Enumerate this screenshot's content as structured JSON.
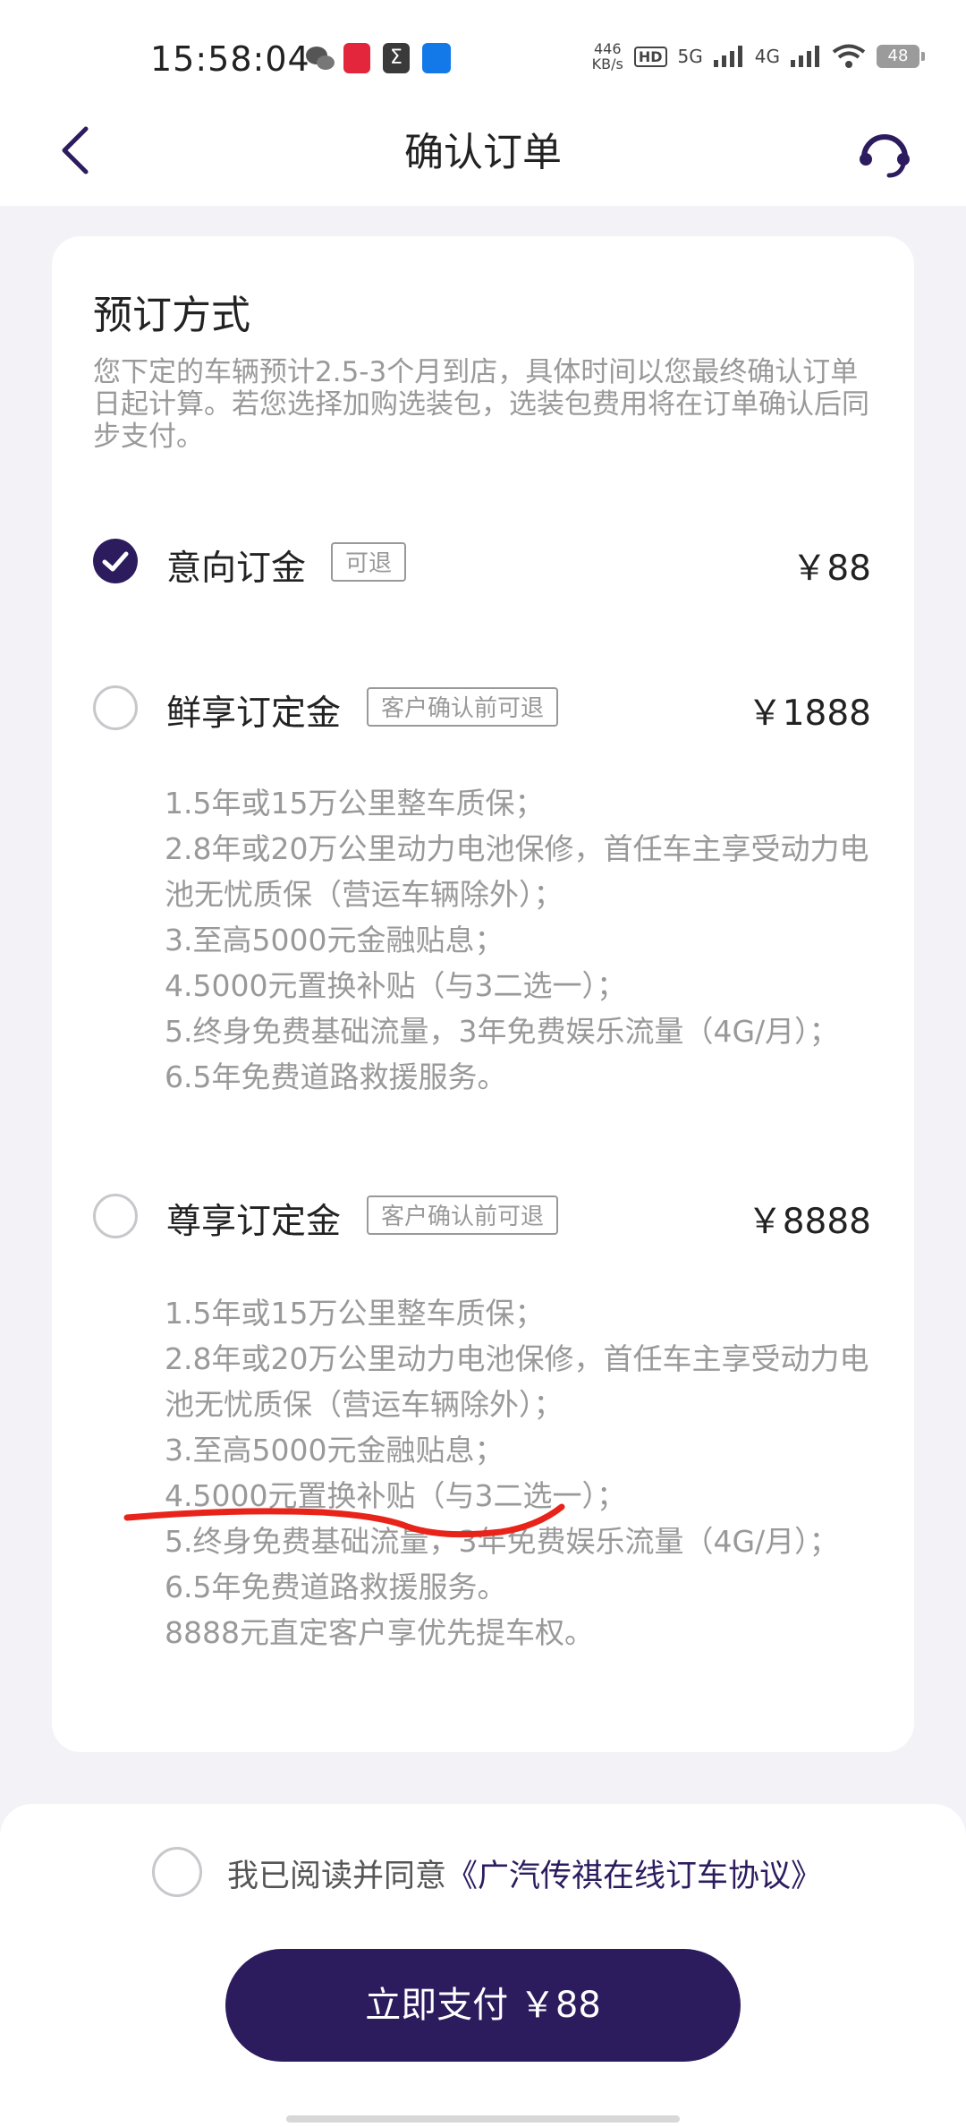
{
  "status_bar": {
    "time": "15:58:04",
    "net_speed_value": "446",
    "net_speed_unit": "KB/s",
    "hd_label": "HD",
    "signal1": "5G",
    "signal2": "4G",
    "battery": "48"
  },
  "header": {
    "title": "确认订单"
  },
  "booking": {
    "title": "预订方式",
    "description": "您下定的车辆预计2.5-3个月到店，具体时间以您最终确认订单日起计算。若您选择加购选装包，选装包费用将在订单确认后同步支付。",
    "options": [
      {
        "name": "意向订金",
        "tag": "可退",
        "price": "￥88",
        "selected": true,
        "benefits": []
      },
      {
        "name": "鲜享订定金",
        "tag": "客户确认前可退",
        "price": "￥1888",
        "selected": false,
        "benefits": [
          "1.5年或15万公里整车质保；",
          "2.8年或20万公里动力电池保修，首任车主享受动力电池无忧质保（营运车辆除外）；",
          "3.至高5000元金融贴息；",
          "4.5000元置换补贴（与3二选一）；",
          "5.终身免费基础流量，3年免费娱乐流量（4G/月）；",
          "6.5年免费道路救援服务。"
        ]
      },
      {
        "name": "尊享订定金",
        "tag": "客户确认前可退",
        "price": "￥8888",
        "selected": false,
        "benefits": [
          "1.5年或15万公里整车质保；",
          "2.8年或20万公里动力电池保修，首任车主享受动力电池无忧质保（营运车辆除外）；",
          "3.至高5000元金融贴息；",
          "4.5000元置换补贴（与3二选一）；",
          "5.终身免费基础流量，3年免费娱乐流量（4G/月）；",
          "6.5年免费道路救援服务。",
          "8888元直定客户享优先提车权。"
        ]
      }
    ]
  },
  "footer": {
    "agree_prefix": "我已阅读并同意",
    "agree_link": "《广汽传祺在线订车协议》",
    "pay_label": "立即支付 ￥88"
  },
  "colors": {
    "brand": "#2c1c5e",
    "annotation": "#e8231a"
  }
}
